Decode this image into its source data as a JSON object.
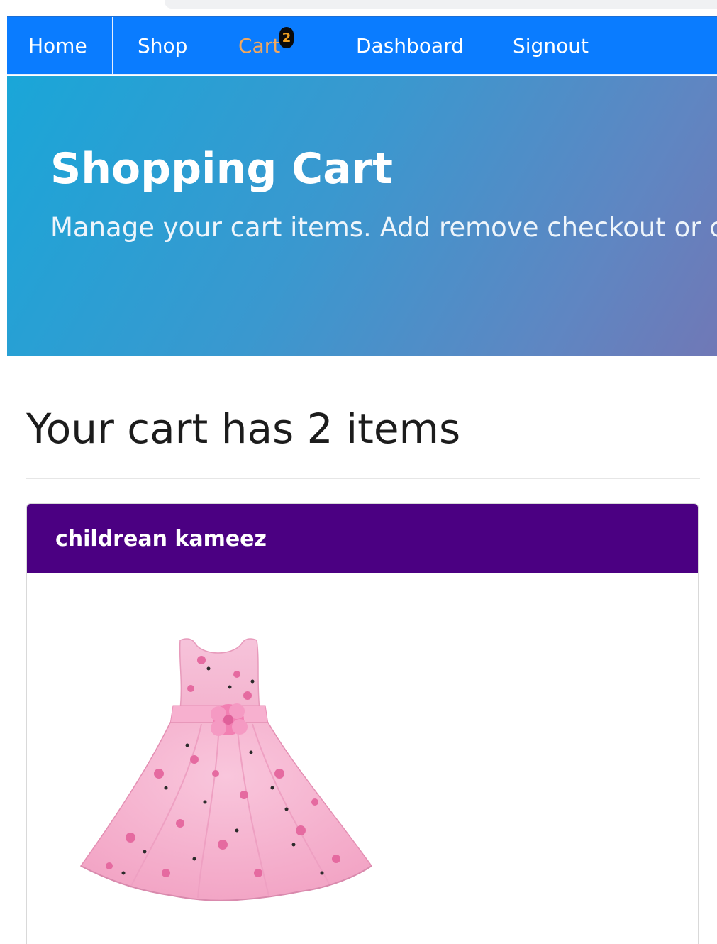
{
  "nav": {
    "items": [
      {
        "label": "Home"
      },
      {
        "label": "Shop"
      },
      {
        "label": "Cart",
        "badge": "2"
      },
      {
        "label": "Dashboard"
      },
      {
        "label": "Signout"
      }
    ]
  },
  "hero": {
    "title": "Shopping Cart",
    "subtitle": "Manage your cart items. Add remove checkout or contir"
  },
  "cart": {
    "heading": "Your cart has 2 items",
    "products": [
      {
        "name": "childrean kameez",
        "image_icon": "pink-floral-dress-image"
      }
    ]
  },
  "colors": {
    "navbar": "#0a7cff",
    "cart_link": "#f0a860",
    "card_header": "#4b0082",
    "hero_gradient_start": "#1aa6d8",
    "hero_gradient_end": "#7078b6"
  }
}
